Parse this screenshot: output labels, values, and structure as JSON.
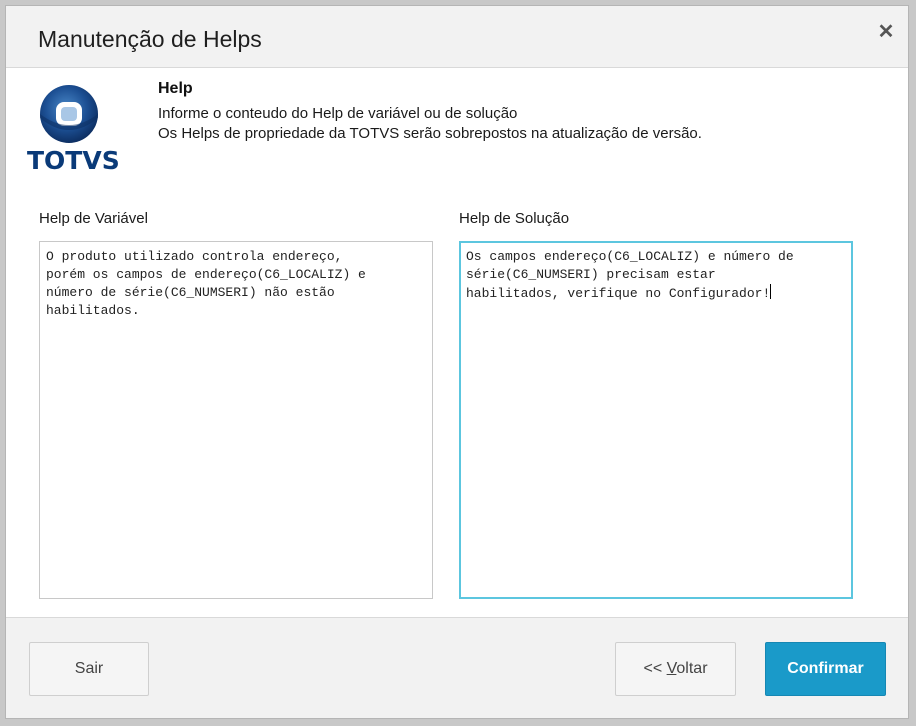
{
  "window": {
    "title": "Manutenção de Helps",
    "close_glyph": "✕"
  },
  "logo": {
    "text": "TOTVS",
    "icon": "totvs-logo-icon"
  },
  "help": {
    "heading": "Help",
    "line1": "Informe o conteudo do Help de variável ou de solução",
    "line2": "Os Helps de propriedade da TOTVS serão sobrepostos na atualização de versão."
  },
  "fields": {
    "variavel": {
      "label": "Help de Variável",
      "value": "O produto utilizado controla endereço,\nporém os campos de endereço(C6_LOCALIZ) e\nnúmero de série(C6_NUMSERI) não estão\nhabilitados."
    },
    "solucao": {
      "label": "Help de Solução",
      "value": "Os campos endereço(C6_LOCALIZ) e número de\nsérie(C6_NUMSERI) precisam estar\nhabilitados, verifique no Configurador!"
    }
  },
  "buttons": {
    "sair": "Sair",
    "voltar_prefix": "<< ",
    "voltar_accel": "V",
    "voltar_rest": "oltar",
    "confirmar": "Confirmar"
  },
  "colors": {
    "accent": "#1a9ac9",
    "focus_border": "#5cc6df",
    "brand": "#0a3a78"
  }
}
